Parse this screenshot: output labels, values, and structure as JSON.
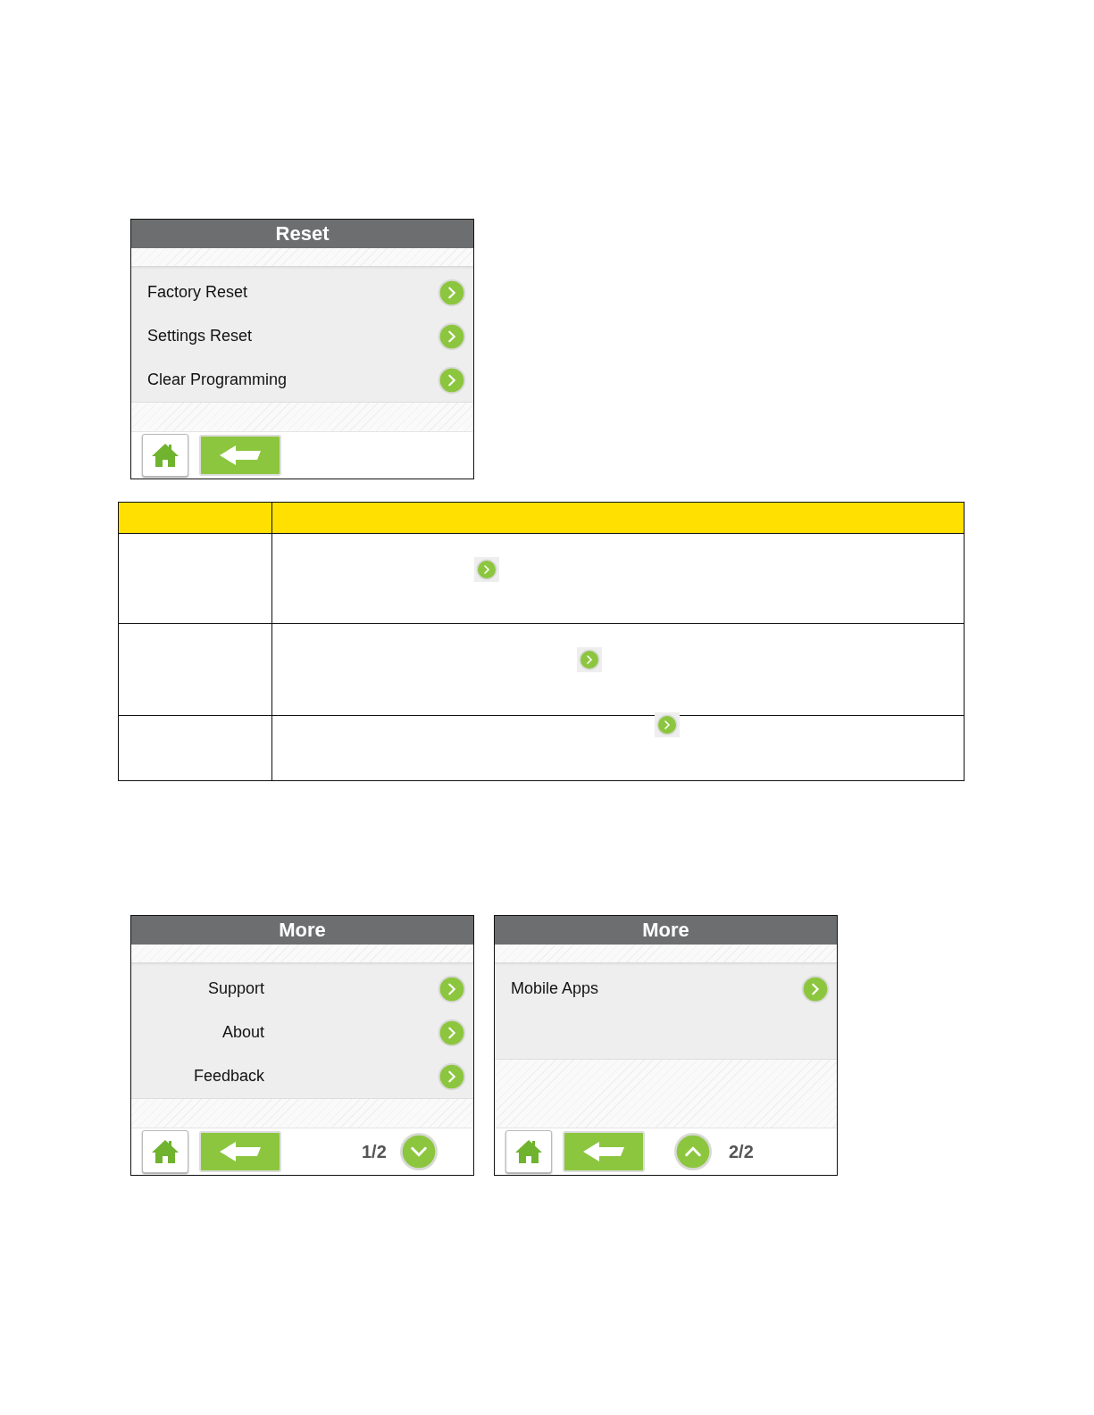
{
  "reset_screen": {
    "title": "Reset",
    "kind": "left",
    "items": [
      {
        "label": "Factory Reset"
      },
      {
        "label": "Settings Reset"
      },
      {
        "label": "Clear Programming"
      }
    ]
  },
  "more_screens": [
    {
      "title": "More",
      "kind": "right",
      "items": [
        {
          "label": "Support"
        },
        {
          "label": "About"
        },
        {
          "label": "Feedback"
        }
      ],
      "pager": {
        "label": "1/2",
        "kind": "down"
      }
    },
    {
      "title": "More",
      "kind": "left",
      "items": [
        {
          "label": "Mobile Apps"
        }
      ],
      "pager": {
        "label": "2/2",
        "kind": "up"
      }
    }
  ]
}
